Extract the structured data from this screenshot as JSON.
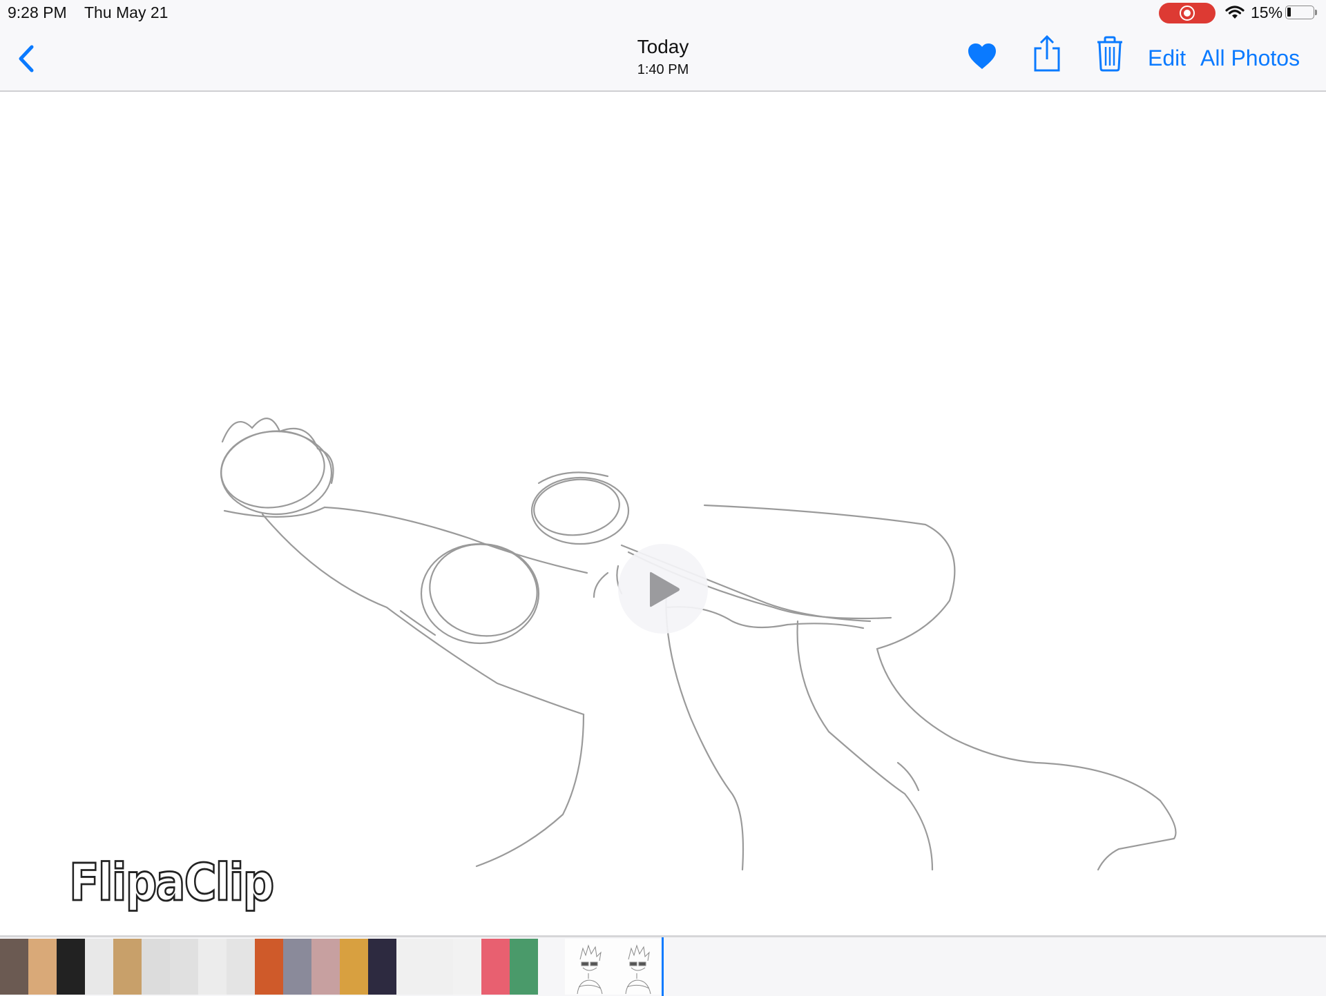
{
  "status_bar": {
    "time": "9:28 PM",
    "date": "Thu May 21",
    "recording": true,
    "battery_percent": "15%",
    "battery_level": 0.15,
    "icons": [
      "screen-recording-icon",
      "wifi-icon",
      "battery-icon"
    ]
  },
  "nav_bar": {
    "back_icon": "chevron-left-icon",
    "title": "Today",
    "subtitle": "1:40 PM",
    "actions": [
      {
        "name": "favorite",
        "icon": "heart-filled-icon"
      },
      {
        "name": "share",
        "icon": "share-icon"
      },
      {
        "name": "delete",
        "icon": "trash-icon"
      }
    ],
    "edit_label": "Edit",
    "all_photos_label": "All Photos"
  },
  "viewer": {
    "media_type": "video",
    "watermark": "FlipaClip",
    "play_icon": "play-icon"
  },
  "scrubber": {
    "thumbnail_colors": [
      "#6b5a52",
      "#d9a978",
      "#222222",
      "#e8e8e8",
      "#c8a06a",
      "#dcdcdc",
      "#e0e0e0",
      "#ececec",
      "#e4e4e4",
      "#cf5a2a",
      "#8a8a9a",
      "#c7a0a0",
      "#d8a040",
      "#2d2a40",
      "#f0f0f0",
      "#f0f0f0",
      "#f2f2f2",
      "#e86070",
      "#4a9a6a"
    ],
    "current_item": "sketch video frames",
    "accent": "#0a7aff"
  },
  "colors": {
    "accent": "#0a7aff",
    "record": "#dd3a33",
    "bar_bg": "#f8f8fa"
  }
}
